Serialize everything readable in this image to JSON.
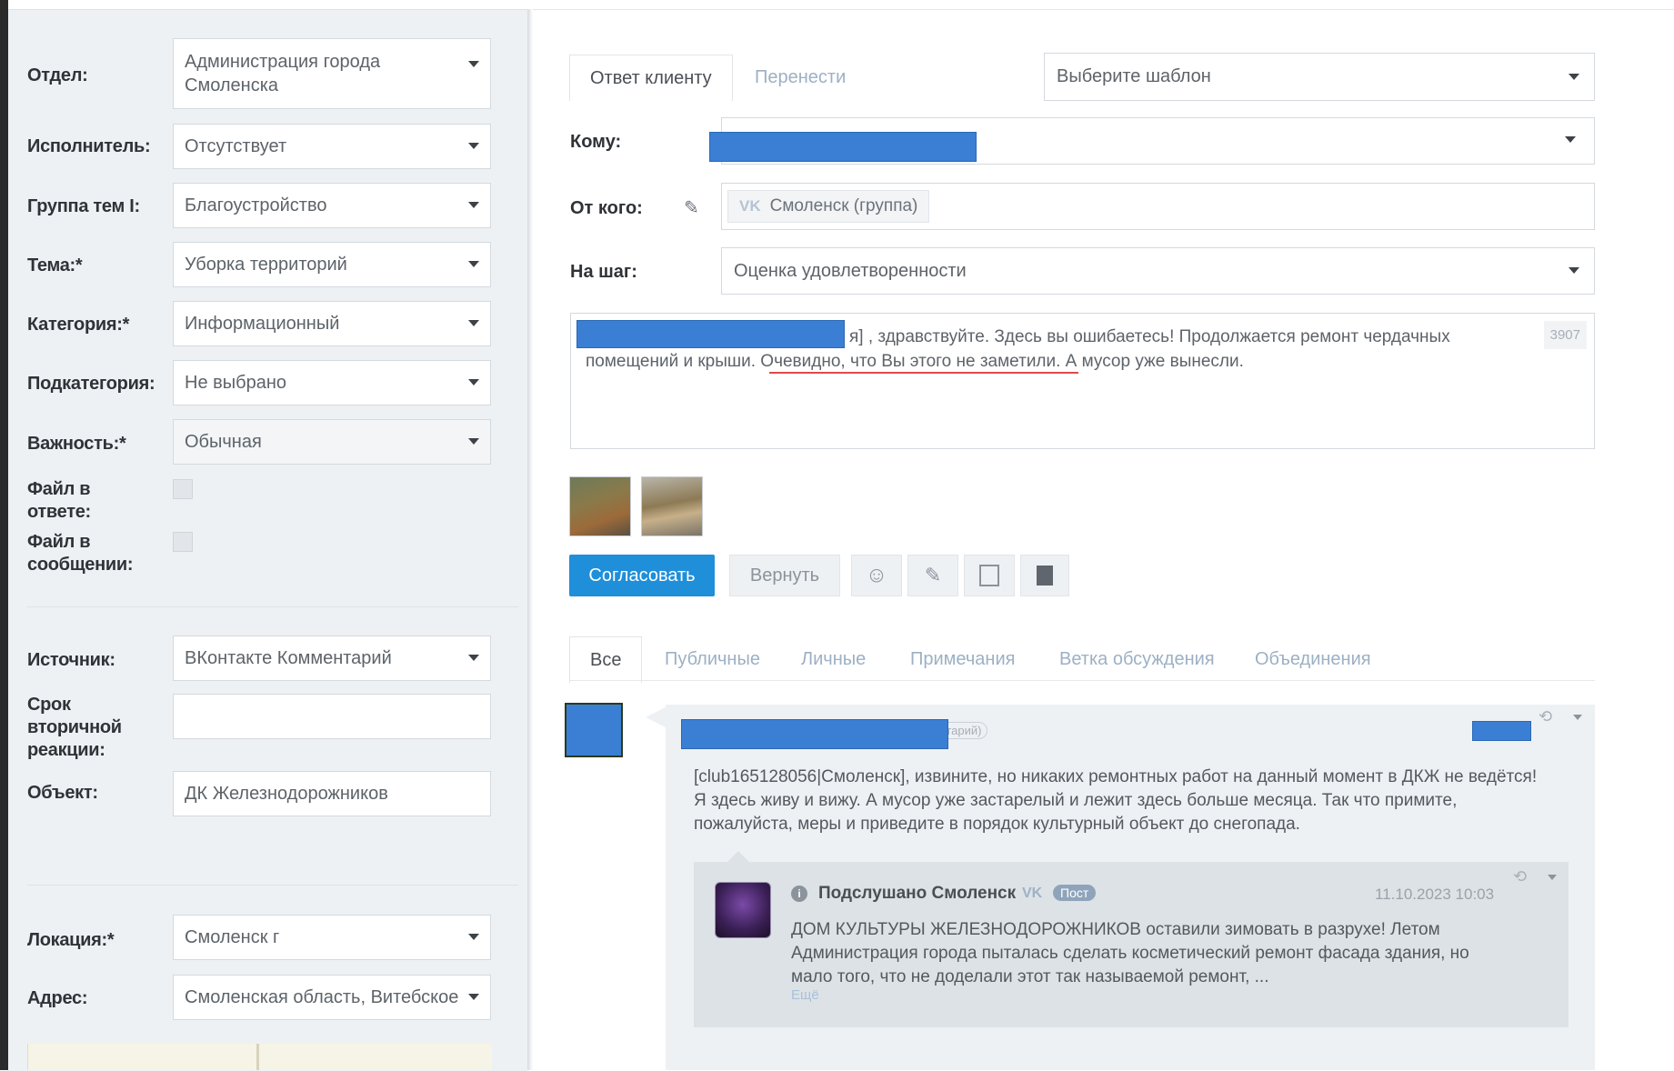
{
  "left_form": {
    "fields": [
      {
        "label": "Отдел:",
        "value": "Администрация города Смоленска"
      },
      {
        "label": "Исполнитель:",
        "value": "Отсутствует"
      },
      {
        "label": "Группа тем I:",
        "value": "Благоустройство"
      },
      {
        "label": "Тема:*",
        "value": "Уборка территорий"
      },
      {
        "label": "Категория:*",
        "value": "Информационный"
      },
      {
        "label": "Подкатегория:",
        "value": "Не выбрано"
      },
      {
        "label": "Важность:*",
        "value": "Обычная"
      }
    ],
    "file_in_answer_label": "Файл в ответе:",
    "file_in_message_label": "Файл в сообщении:",
    "source_label": "Источник:",
    "source_value": "ВКонтакте Комментарий",
    "deadline_label": "Срок вторичной реакции:",
    "deadline_value": "",
    "object_label": "Объект:",
    "object_value": "ДК Железнодорожников",
    "location_label": "Локация:*",
    "location_value": "Смоленск г",
    "address_label": "Адрес:",
    "address_value": "Смоленская область, Витебское"
  },
  "reply": {
    "tabs": [
      "Ответ клиенту",
      "Перенести"
    ],
    "template_placeholder": "Выберите шаблон",
    "to_label": "Кому:",
    "from_label": "От кого:",
    "from_value": "Смоленск (группа)",
    "vk_badge": "VK",
    "step_label": "На шаг:",
    "step_value": "Оценка удовлетворенности",
    "message_prefix": "я] , здравствуйте. Здесь вы ошибаетесь! Продолжается ремонт чердачных помещений и крыши. Очевидно, что Вы этого не заметили. А мусор уже вынесли.",
    "char_counter": "3907",
    "approve_button": "Согласовать",
    "return_button": "Вернуть"
  },
  "feed": {
    "tabs": [
      "Все",
      "Публичные",
      "Личные",
      "Примечания",
      "Ветка обсуждения",
      "Объединения"
    ],
    "comment_badge": "ментарий)",
    "comment_text": "[club165128056|Смоленск], извините, но никаких ремонтных работ на данный момент в ДКЖ не ведётся! Я здесь живу и вижу. А мусор уже застарелый и лежит здесь больше месяца. Так что примите, пожалуйста, меры и приведите в порядок культурный объект до снегопада.",
    "quote": {
      "author": "Подслушано Смоленск",
      "vk_badge": "VK",
      "type_badge": "Пост",
      "date": "11.10.2023 10:03",
      "text": "ДОМ КУЛЬТУРЫ ЖЕЛЕЗНОДОРОЖНИКОВ оставили зимовать в разрухе! Летом Администрация города пыталась сделать косметический ремонт фасада здания, но мало того, что не доделали этот так называемой ремонт, ...",
      "more": "Ещё"
    }
  }
}
